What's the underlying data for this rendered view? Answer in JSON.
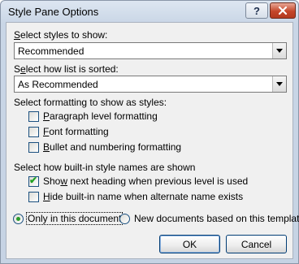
{
  "window": {
    "title": "Style Pane Options",
    "help_label": "?",
    "close_icon": "close-icon"
  },
  "styles_to_show": {
    "label_key": "S",
    "label_rest": "elect styles to show:",
    "value": "Recommended"
  },
  "sort": {
    "label_pre": "S",
    "label_key": "e",
    "label_rest": "lect how list is sorted:",
    "value": "As Recommended"
  },
  "formatting": {
    "label": "Select formatting to show as styles:",
    "options": [
      {
        "key": "P",
        "rest": "aragraph level formatting",
        "checked": false
      },
      {
        "key": "F",
        "rest": "ont formatting",
        "checked": false
      },
      {
        "key": "B",
        "rest": "ullet and numbering formatting",
        "checked": false
      }
    ]
  },
  "builtin": {
    "label": "Select how built-in style names are shown",
    "options": [
      {
        "pre": "Sho",
        "key": "w",
        "rest": " next heading when previous level is used",
        "checked": true
      },
      {
        "pre": "",
        "key": "H",
        "rest": "ide built-in name when alternate name exists",
        "checked": false
      }
    ]
  },
  "scope": {
    "options": [
      {
        "label": "Only in this document",
        "selected": true
      },
      {
        "label": "New documents based on this template",
        "selected": false
      }
    ]
  },
  "buttons": {
    "ok": "OK",
    "cancel": "Cancel"
  },
  "colors": {
    "title_bar": "#c9d6e6",
    "close_button": "#c4462a",
    "dialog_bg": "#f0f0f0",
    "check_green": "#21a121"
  }
}
